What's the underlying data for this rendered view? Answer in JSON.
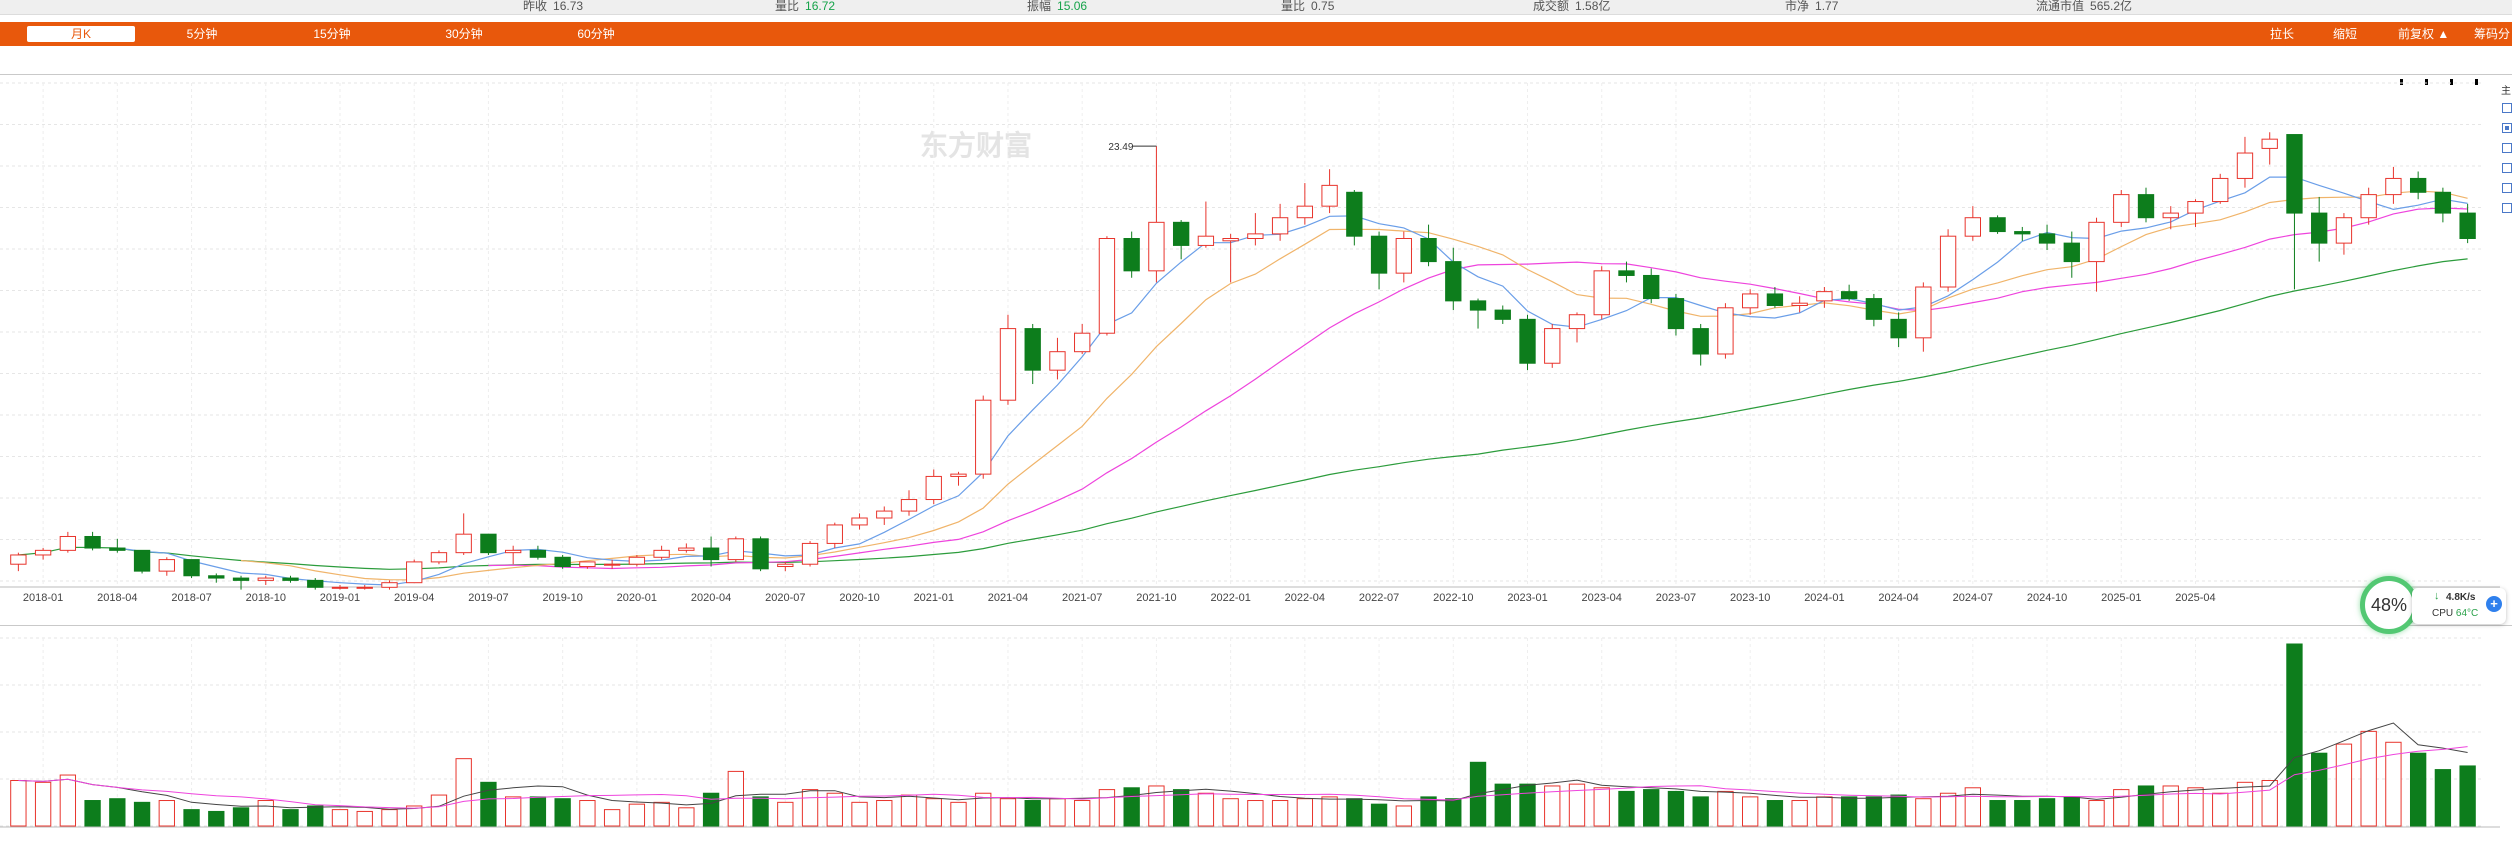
{
  "header": {
    "quotes": [
      {
        "label": "昨收",
        "value": "16.73",
        "color": "#555555"
      },
      {
        "label": "量比",
        "value": "16.72",
        "color": "#16a34a"
      },
      {
        "label": "振幅",
        "value": "15.06",
        "color": "#16a34a"
      },
      {
        "label": "量比",
        "value": "0.75",
        "color": "#555555"
      },
      {
        "label": "成交额",
        "value": "1.58亿",
        "color": "#555555"
      },
      {
        "label": "市净",
        "value": "1.77",
        "color": "#555555"
      },
      {
        "label": "流通市值",
        "value": "565.2亿",
        "color": "#555555"
      }
    ]
  },
  "toolbar": {
    "tabs": [
      "月K",
      "5分钟",
      "15分钟",
      "30分钟",
      "60分钟"
    ],
    "active_tab": "月K",
    "right_tools": [
      "拉长",
      "缩短",
      "前复权 ▲",
      "筹码分"
    ]
  },
  "watermark": "东方财富",
  "side_label": "主",
  "cpu_widget": {
    "percent": "48%",
    "net_speed": "4.8K/s",
    "cpu_label": "CPU",
    "cpu_temp": "64°C",
    "add_icon": "+"
  },
  "colors": {
    "up": "#e8342c",
    "down": "#0d7d1c",
    "ma5": "#6a9ee8",
    "ma10": "#f0b46a",
    "ma20": "#ee44dd",
    "ma60": "#2c9c3c",
    "accent": "#e8580c"
  },
  "chart_data": {
    "type": "candlestick",
    "title": "",
    "x_tick_labels": [
      "2018-01",
      "2018-04",
      "2018-07",
      "2018-10",
      "2019-01",
      "2019-04",
      "2019-07",
      "2019-10",
      "2020-01",
      "2020-04",
      "2020-07",
      "2020-10",
      "2021-01",
      "2021-04",
      "2021-07",
      "2021-10",
      "2022-01",
      "2022-04",
      "2022-07",
      "2022-10",
      "2023-01",
      "2023-04",
      "2023-07",
      "2023-10",
      "2024-01",
      "2024-04",
      "2024-07",
      "2024-10",
      "2025-01",
      "2025-04"
    ],
    "high_marker": "23.49",
    "price_range": [
      4.5,
      24.5
    ],
    "candles": [
      {
        "o": 5.4,
        "h": 5.9,
        "l": 5.1,
        "c": 5.8,
        "v": 25
      },
      {
        "o": 5.8,
        "h": 6.1,
        "l": 5.6,
        "c": 6.0,
        "v": 24
      },
      {
        "o": 6.0,
        "h": 6.8,
        "l": 5.9,
        "c": 6.6,
        "v": 28
      },
      {
        "o": 6.6,
        "h": 6.8,
        "l": 6.0,
        "c": 6.1,
        "v": 14
      },
      {
        "o": 6.1,
        "h": 6.5,
        "l": 5.9,
        "c": 6.0,
        "v": 15
      },
      {
        "o": 6.0,
        "h": 6.0,
        "l": 5.0,
        "c": 5.1,
        "v": 13
      },
      {
        "o": 5.1,
        "h": 5.7,
        "l": 4.9,
        "c": 5.6,
        "v": 14
      },
      {
        "o": 5.6,
        "h": 5.6,
        "l": 4.8,
        "c": 4.9,
        "v": 9
      },
      {
        "o": 4.9,
        "h": 5.0,
        "l": 4.6,
        "c": 4.8,
        "v": 8
      },
      {
        "o": 4.8,
        "h": 4.9,
        "l": 4.3,
        "c": 4.7,
        "v": 10
      },
      {
        "o": 4.7,
        "h": 4.9,
        "l": 4.5,
        "c": 4.8,
        "v": 14
      },
      {
        "o": 4.8,
        "h": 4.9,
        "l": 4.6,
        "c": 4.7,
        "v": 9
      },
      {
        "o": 4.7,
        "h": 4.8,
        "l": 4.3,
        "c": 4.4,
        "v": 11
      },
      {
        "o": 4.4,
        "h": 4.5,
        "l": 4.3,
        "c": 4.4,
        "v": 9
      },
      {
        "o": 4.4,
        "h": 4.5,
        "l": 4.3,
        "c": 4.4,
        "v": 8
      },
      {
        "o": 4.4,
        "h": 4.7,
        "l": 4.3,
        "c": 4.6,
        "v": 9
      },
      {
        "o": 4.6,
        "h": 5.6,
        "l": 4.6,
        "c": 5.5,
        "v": 11
      },
      {
        "o": 5.5,
        "h": 6.0,
        "l": 5.4,
        "c": 5.9,
        "v": 17
      },
      {
        "o": 5.9,
        "h": 7.6,
        "l": 5.8,
        "c": 6.7,
        "v": 37
      },
      {
        "o": 6.7,
        "h": 6.7,
        "l": 5.8,
        "c": 5.9,
        "v": 24
      },
      {
        "o": 5.9,
        "h": 6.2,
        "l": 5.4,
        "c": 6.0,
        "v": 16
      },
      {
        "o": 6.0,
        "h": 6.2,
        "l": 5.6,
        "c": 5.7,
        "v": 16
      },
      {
        "o": 5.7,
        "h": 5.8,
        "l": 5.2,
        "c": 5.3,
        "v": 15
      },
      {
        "o": 5.3,
        "h": 5.5,
        "l": 5.2,
        "c": 5.5,
        "v": 14
      },
      {
        "o": 5.4,
        "h": 5.6,
        "l": 5.2,
        "c": 5.4,
        "v": 9
      },
      {
        "o": 5.4,
        "h": 5.8,
        "l": 5.3,
        "c": 5.7,
        "v": 12
      },
      {
        "o": 5.7,
        "h": 6.2,
        "l": 5.6,
        "c": 6.0,
        "v": 13
      },
      {
        "o": 6.0,
        "h": 6.3,
        "l": 5.9,
        "c": 6.1,
        "v": 10
      },
      {
        "o": 6.1,
        "h": 6.6,
        "l": 5.3,
        "c": 5.6,
        "v": 18
      },
      {
        "o": 5.6,
        "h": 6.6,
        "l": 5.5,
        "c": 6.5,
        "v": 30
      },
      {
        "o": 6.5,
        "h": 6.6,
        "l": 5.1,
        "c": 5.2,
        "v": 16
      },
      {
        "o": 5.3,
        "h": 5.5,
        "l": 5.1,
        "c": 5.4,
        "v": 13
      },
      {
        "o": 5.4,
        "h": 6.4,
        "l": 5.3,
        "c": 6.3,
        "v": 20
      },
      {
        "o": 6.3,
        "h": 7.2,
        "l": 6.1,
        "c": 7.1,
        "v": 18
      },
      {
        "o": 7.1,
        "h": 7.6,
        "l": 6.9,
        "c": 7.4,
        "v": 13
      },
      {
        "o": 7.4,
        "h": 7.9,
        "l": 7.1,
        "c": 7.7,
        "v": 14
      },
      {
        "o": 7.7,
        "h": 8.6,
        "l": 7.5,
        "c": 8.2,
        "v": 17
      },
      {
        "o": 8.2,
        "h": 9.5,
        "l": 8.0,
        "c": 9.2,
        "v": 15
      },
      {
        "o": 9.2,
        "h": 9.4,
        "l": 8.8,
        "c": 9.3,
        "v": 13
      },
      {
        "o": 9.3,
        "h": 12.7,
        "l": 9.1,
        "c": 12.5,
        "v": 18
      },
      {
        "o": 12.5,
        "h": 16.2,
        "l": 12.3,
        "c": 15.6,
        "v": 15
      },
      {
        "o": 15.6,
        "h": 15.8,
        "l": 13.2,
        "c": 13.8,
        "v": 14
      },
      {
        "o": 13.8,
        "h": 15.2,
        "l": 13.4,
        "c": 14.6,
        "v": 15
      },
      {
        "o": 14.6,
        "h": 15.8,
        "l": 14.5,
        "c": 15.4,
        "v": 14
      },
      {
        "o": 15.4,
        "h": 19.6,
        "l": 15.3,
        "c": 19.5,
        "v": 20
      },
      {
        "o": 19.5,
        "h": 19.8,
        "l": 17.8,
        "c": 18.1,
        "v": 21
      },
      {
        "o": 18.1,
        "h": 23.5,
        "l": 17.6,
        "c": 20.2,
        "v": 22
      },
      {
        "o": 20.2,
        "h": 20.3,
        "l": 18.6,
        "c": 19.2,
        "v": 20
      },
      {
        "o": 19.2,
        "h": 21.1,
        "l": 19.1,
        "c": 19.6,
        "v": 18
      },
      {
        "o": 19.4,
        "h": 19.7,
        "l": 17.6,
        "c": 19.5,
        "v": 15
      },
      {
        "o": 19.5,
        "h": 20.6,
        "l": 19.2,
        "c": 19.7,
        "v": 14
      },
      {
        "o": 19.7,
        "h": 21.0,
        "l": 19.4,
        "c": 20.4,
        "v": 14
      },
      {
        "o": 20.4,
        "h": 21.9,
        "l": 20.1,
        "c": 20.9,
        "v": 15
      },
      {
        "o": 20.9,
        "h": 22.5,
        "l": 20.6,
        "c": 21.8,
        "v": 16
      },
      {
        "o": 21.5,
        "h": 21.6,
        "l": 19.2,
        "c": 19.6,
        "v": 15
      },
      {
        "o": 19.6,
        "h": 19.8,
        "l": 17.3,
        "c": 18.0,
        "v": 12
      },
      {
        "o": 18.0,
        "h": 19.8,
        "l": 17.6,
        "c": 19.5,
        "v": 11
      },
      {
        "o": 19.5,
        "h": 20.1,
        "l": 18.3,
        "c": 18.5,
        "v": 16
      },
      {
        "o": 18.5,
        "h": 19.1,
        "l": 16.4,
        "c": 16.8,
        "v": 15
      },
      {
        "o": 16.8,
        "h": 16.9,
        "l": 15.6,
        "c": 16.4,
        "v": 35
      },
      {
        "o": 16.4,
        "h": 16.6,
        "l": 15.8,
        "c": 16.0,
        "v": 23
      },
      {
        "o": 16.0,
        "h": 16.2,
        "l": 13.8,
        "c": 14.1,
        "v": 23
      },
      {
        "o": 14.1,
        "h": 15.8,
        "l": 13.9,
        "c": 15.6,
        "v": 22
      },
      {
        "o": 15.6,
        "h": 16.3,
        "l": 15.0,
        "c": 16.2,
        "v": 23
      },
      {
        "o": 16.2,
        "h": 18.3,
        "l": 16.0,
        "c": 18.1,
        "v": 21
      },
      {
        "o": 18.1,
        "h": 18.5,
        "l": 17.6,
        "c": 17.9,
        "v": 19
      },
      {
        "o": 17.9,
        "h": 18.2,
        "l": 16.7,
        "c": 16.9,
        "v": 20
      },
      {
        "o": 16.9,
        "h": 17.1,
        "l": 15.3,
        "c": 15.6,
        "v": 19
      },
      {
        "o": 15.6,
        "h": 15.8,
        "l": 14.0,
        "c": 14.5,
        "v": 16
      },
      {
        "o": 14.5,
        "h": 16.7,
        "l": 14.3,
        "c": 16.5,
        "v": 19
      },
      {
        "o": 16.5,
        "h": 17.3,
        "l": 16.2,
        "c": 17.1,
        "v": 16
      },
      {
        "o": 17.1,
        "h": 17.4,
        "l": 16.5,
        "c": 16.6,
        "v": 14
      },
      {
        "o": 16.6,
        "h": 17.0,
        "l": 16.3,
        "c": 16.7,
        "v": 14
      },
      {
        "o": 16.8,
        "h": 17.4,
        "l": 16.5,
        "c": 17.2,
        "v": 16
      },
      {
        "o": 17.2,
        "h": 17.5,
        "l": 16.8,
        "c": 16.9,
        "v": 16
      },
      {
        "o": 16.9,
        "h": 17.1,
        "l": 15.7,
        "c": 16.0,
        "v": 16
      },
      {
        "o": 16.0,
        "h": 16.3,
        "l": 14.8,
        "c": 15.2,
        "v": 17
      },
      {
        "o": 15.2,
        "h": 17.6,
        "l": 14.6,
        "c": 17.4,
        "v": 15
      },
      {
        "o": 17.4,
        "h": 19.9,
        "l": 17.2,
        "c": 19.6,
        "v": 18
      },
      {
        "o": 19.6,
        "h": 20.9,
        "l": 19.4,
        "c": 20.4,
        "v": 21
      },
      {
        "o": 20.4,
        "h": 20.5,
        "l": 19.7,
        "c": 19.8,
        "v": 14
      },
      {
        "o": 19.8,
        "h": 20.0,
        "l": 19.4,
        "c": 19.7,
        "v": 14
      },
      {
        "o": 19.7,
        "h": 20.1,
        "l": 19.0,
        "c": 19.3,
        "v": 15
      },
      {
        "o": 19.3,
        "h": 19.8,
        "l": 17.8,
        "c": 18.5,
        "v": 16
      },
      {
        "o": 18.5,
        "h": 20.4,
        "l": 17.2,
        "c": 20.2,
        "v": 14
      },
      {
        "o": 20.2,
        "h": 21.6,
        "l": 20.0,
        "c": 21.4,
        "v": 20
      },
      {
        "o": 21.4,
        "h": 21.7,
        "l": 20.2,
        "c": 20.4,
        "v": 22
      },
      {
        "o": 20.4,
        "h": 20.9,
        "l": 19.9,
        "c": 20.6,
        "v": 22
      },
      {
        "o": 20.6,
        "h": 21.2,
        "l": 20.0,
        "c": 21.1,
        "v": 21
      },
      {
        "o": 21.1,
        "h": 22.3,
        "l": 21.0,
        "c": 22.1,
        "v": 18
      },
      {
        "o": 22.1,
        "h": 23.9,
        "l": 21.7,
        "c": 23.2,
        "v": 24
      },
      {
        "o": 23.4,
        "h": 24.1,
        "l": 22.7,
        "c": 23.8,
        "v": 25
      },
      {
        "o": 24.0,
        "h": 24.0,
        "l": 17.3,
        "c": 20.6,
        "v": 100
      },
      {
        "o": 20.6,
        "h": 21.3,
        "l": 18.5,
        "c": 19.3,
        "v": 40
      },
      {
        "o": 19.3,
        "h": 20.6,
        "l": 18.8,
        "c": 20.4,
        "v": 45
      },
      {
        "o": 20.4,
        "h": 21.7,
        "l": 20.1,
        "c": 21.4,
        "v": 52
      },
      {
        "o": 21.4,
        "h": 22.6,
        "l": 21.0,
        "c": 22.1,
        "v": 46
      },
      {
        "o": 22.1,
        "h": 22.4,
        "l": 21.2,
        "c": 21.5,
        "v": 40
      },
      {
        "o": 21.5,
        "h": 21.7,
        "l": 20.2,
        "c": 20.6,
        "v": 31
      },
      {
        "o": 20.6,
        "h": 21.0,
        "l": 19.3,
        "c": 19.5,
        "v": 33
      }
    ]
  }
}
